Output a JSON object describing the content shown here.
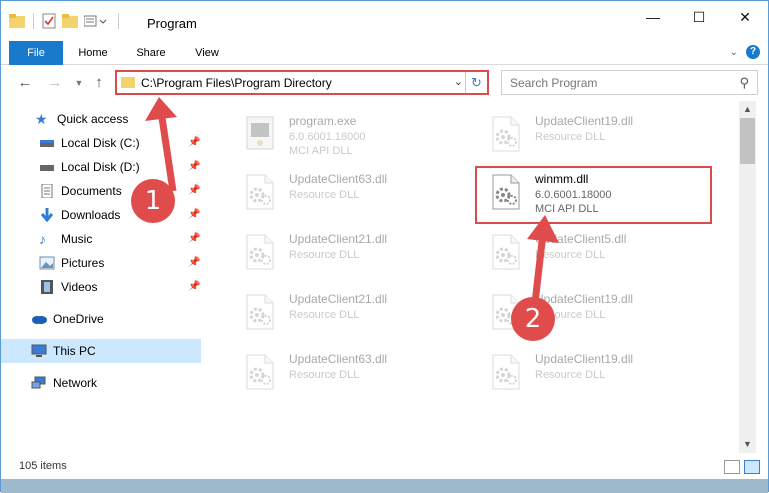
{
  "window": {
    "title": "Program"
  },
  "ribbon": {
    "tabs": [
      "File",
      "Home",
      "Share",
      "View"
    ]
  },
  "address": {
    "path": "C:\\Program Files\\Program Directory"
  },
  "search": {
    "placeholder": "Search Program"
  },
  "sidebar": {
    "items": [
      {
        "label": "Quick access",
        "icon": "star-icon"
      },
      {
        "label": "Local Disk (C:)",
        "icon": "drive-icon",
        "pinned": true
      },
      {
        "label": "Local Disk (D:)",
        "icon": "drive-icon",
        "pinned": true
      },
      {
        "label": "Documents",
        "icon": "documents-icon",
        "pinned": true
      },
      {
        "label": "Downloads",
        "icon": "downloads-icon",
        "pinned": true
      },
      {
        "label": "Music",
        "icon": "music-icon",
        "pinned": true
      },
      {
        "label": "Pictures",
        "icon": "pictures-icon",
        "pinned": true
      },
      {
        "label": "Videos",
        "icon": "videos-icon",
        "pinned": true
      },
      {
        "label": "OneDrive",
        "icon": "cloud-icon"
      },
      {
        "label": "This PC",
        "icon": "pc-icon",
        "selected": true
      },
      {
        "label": "Network",
        "icon": "network-icon"
      }
    ]
  },
  "files": [
    {
      "name": "program.exe",
      "line1": "6.0.6001.18000",
      "line2": "MCI API DLL",
      "faded": true,
      "kind": "exe"
    },
    {
      "name": "UpdateClient19.dll",
      "line1": "Resource DLL",
      "faded": true,
      "kind": "dll"
    },
    {
      "name": "UpdateClient63.dll",
      "line1": "Resource DLL",
      "faded": true,
      "kind": "dll"
    },
    {
      "name": "winmm.dll",
      "line1": "6.0.6001.18000",
      "line2": "MCI API DLL",
      "faded": false,
      "kind": "dll",
      "highlighted": true
    },
    {
      "name": "UpdateClient21.dll",
      "line1": "Resource DLL",
      "faded": true,
      "kind": "dll"
    },
    {
      "name": "UpdateClient5.dll",
      "line1": "Resource DLL",
      "faded": true,
      "kind": "dll"
    },
    {
      "name": "UpdateClient21.dll",
      "line1": "Resource DLL",
      "faded": true,
      "kind": "dll"
    },
    {
      "name": "UpdateClient19.dll",
      "line1": "Resource DLL",
      "faded": true,
      "kind": "dll"
    },
    {
      "name": "UpdateClient63.dll",
      "line1": "Resource DLL",
      "faded": true,
      "kind": "dll"
    },
    {
      "name": "UpdateClient19.dll",
      "line1": "Resource DLL",
      "faded": true,
      "kind": "dll"
    }
  ],
  "status": {
    "count": "105 items"
  },
  "callouts": [
    "1",
    "2"
  ],
  "colors": {
    "accent": "#1979ca",
    "highlight": "#d94c4c",
    "selected": "#cce8ff"
  }
}
